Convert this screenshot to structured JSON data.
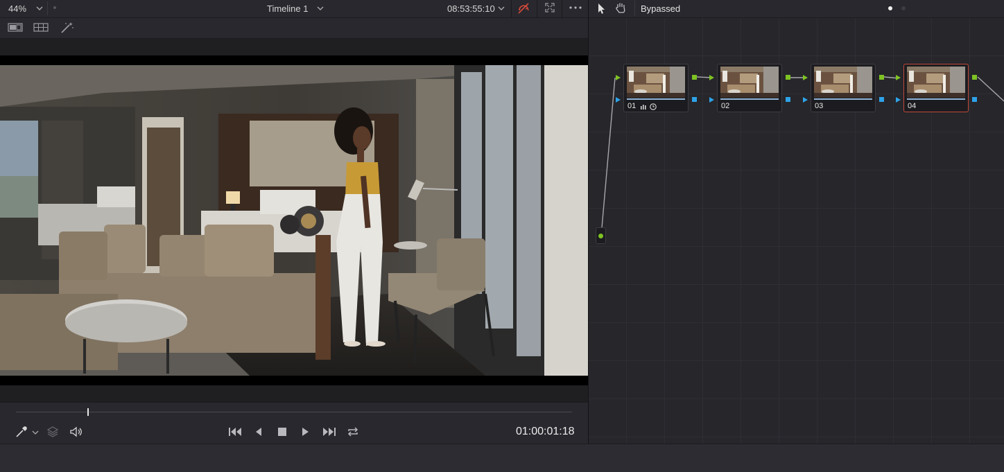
{
  "viewer": {
    "zoom": "44%",
    "timeline_name": "Timeline 1",
    "source_timecode": "08:53:55:10",
    "playhead_timecode": "01:00:01:18",
    "scrubber_position": 0.13
  },
  "nodes": {
    "mode_label": "Bypassed",
    "list": [
      {
        "label": "01"
      },
      {
        "label": "02"
      },
      {
        "label": "03"
      },
      {
        "label": "04"
      }
    ]
  },
  "colors": {
    "accent_green": "#7ec322",
    "accent_blue": "#2ea3e8",
    "selected_node_border": "#c24a3a"
  },
  "icons": [
    "chevron-down-icon",
    "single-viewer-icon",
    "split-viewer-icon",
    "magic-wand-icon",
    "bypass-icon",
    "fullscreen-icon",
    "more-icon",
    "pointer-icon",
    "hand-icon",
    "eyedropper-icon",
    "layers-icon",
    "speaker-icon",
    "skip-to-start-icon",
    "step-back-icon",
    "stop-icon",
    "play-icon",
    "skip-to-end-icon",
    "loop-icon"
  ]
}
